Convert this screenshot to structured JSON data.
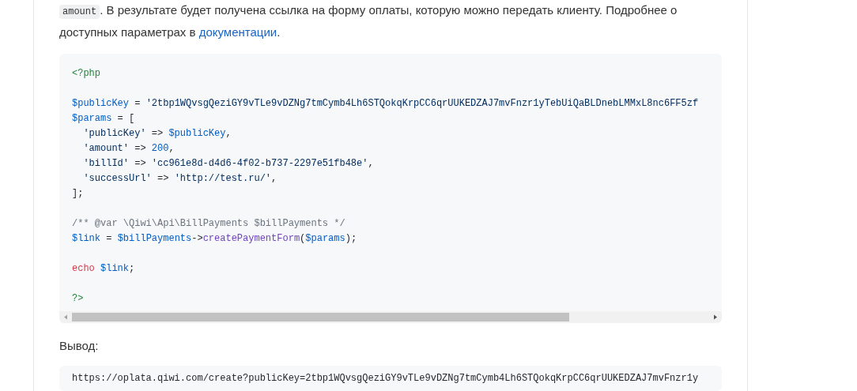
{
  "intro": {
    "inline_code": "amount",
    "text": ". В результате будет получена ссылка на форму оплаты, которую можно передать клиенту. Подробнее о доступных параметрах в ",
    "link": "документации",
    "end": "."
  },
  "code_block": {
    "lines": [
      {
        "kind": "code",
        "indented": false,
        "tokens": [
          {
            "kind": "meta",
            "t": "<?php"
          }
        ]
      },
      {
        "kind": "blank"
      },
      {
        "kind": "code",
        "indented": false,
        "tokens": [
          {
            "kind": "var",
            "t": "$publicKey"
          },
          {
            "kind": "plain",
            "t": " = "
          },
          {
            "kind": "string",
            "t": "'2tbp1WQvsgQeziGY9vTLe9vDZNg7tmCymb4Lh6STQokqKrpCC6qrUUKEDZAJ7mvFnzr1yTebUiQaBLDnebLMMxL8nc6FF5zf"
          }
        ]
      },
      {
        "kind": "code",
        "indented": false,
        "tokens": [
          {
            "kind": "var",
            "t": "$params"
          },
          {
            "kind": "plain",
            "t": " = ["
          }
        ]
      },
      {
        "kind": "code",
        "indented": true,
        "tokens": [
          {
            "kind": "string",
            "t": "'publicKey'"
          },
          {
            "kind": "plain",
            "t": " => "
          },
          {
            "kind": "var",
            "t": "$publicKey"
          },
          {
            "kind": "plain",
            "t": ","
          }
        ]
      },
      {
        "kind": "code",
        "indented": true,
        "tokens": [
          {
            "kind": "string",
            "t": "'amount'"
          },
          {
            "kind": "plain",
            "t": " => "
          },
          {
            "kind": "number",
            "t": "200"
          },
          {
            "kind": "plain",
            "t": ","
          }
        ]
      },
      {
        "kind": "code",
        "indented": true,
        "tokens": [
          {
            "kind": "string",
            "t": "'billId'"
          },
          {
            "kind": "plain",
            "t": " => "
          },
          {
            "kind": "string",
            "t": "'cc961e8d-d4d6-4f02-b737-2297e51fb48e'"
          },
          {
            "kind": "plain",
            "t": ","
          }
        ]
      },
      {
        "kind": "code",
        "indented": true,
        "tokens": [
          {
            "kind": "string",
            "t": "'successUrl'"
          },
          {
            "kind": "plain",
            "t": " => "
          },
          {
            "kind": "string",
            "t": "'http://test.ru/'"
          },
          {
            "kind": "plain",
            "t": ","
          }
        ]
      },
      {
        "kind": "code",
        "indented": false,
        "tokens": [
          {
            "kind": "plain",
            "t": "];"
          }
        ]
      },
      {
        "kind": "blank"
      },
      {
        "kind": "code",
        "indented": false,
        "tokens": [
          {
            "kind": "comment",
            "t": "/** @var \\Qiwi\\Api\\BillPayments $billPayments */"
          }
        ]
      },
      {
        "kind": "code",
        "indented": false,
        "tokens": [
          {
            "kind": "var",
            "t": "$link"
          },
          {
            "kind": "plain",
            "t": " = "
          },
          {
            "kind": "var",
            "t": "$billPayments"
          },
          {
            "kind": "plain",
            "t": "->"
          },
          {
            "kind": "function",
            "t": "createPaymentForm"
          },
          {
            "kind": "plain",
            "t": "("
          },
          {
            "kind": "var",
            "t": "$params"
          },
          {
            "kind": "plain",
            "t": ");"
          }
        ]
      },
      {
        "kind": "blank"
      },
      {
        "kind": "code",
        "indented": false,
        "tokens": [
          {
            "kind": "keyword",
            "t": "echo"
          },
          {
            "kind": "var",
            "t": " $link"
          },
          {
            "kind": "plain",
            "t": ";"
          }
        ]
      },
      {
        "kind": "blank"
      },
      {
        "kind": "code",
        "indented": false,
        "tokens": [
          {
            "kind": "meta",
            "t": "?>"
          }
        ]
      }
    ]
  },
  "output_label": "Вывод:",
  "output_block": {
    "text": "https://oplata.qiwi.com/create?publicKey=2tbp1WQvsgQeziGY9vTLe9vDZNg7tmCymb4Lh6STQokqKrpCC6qrUUKEDZAJ7mvFnzr1y"
  }
}
